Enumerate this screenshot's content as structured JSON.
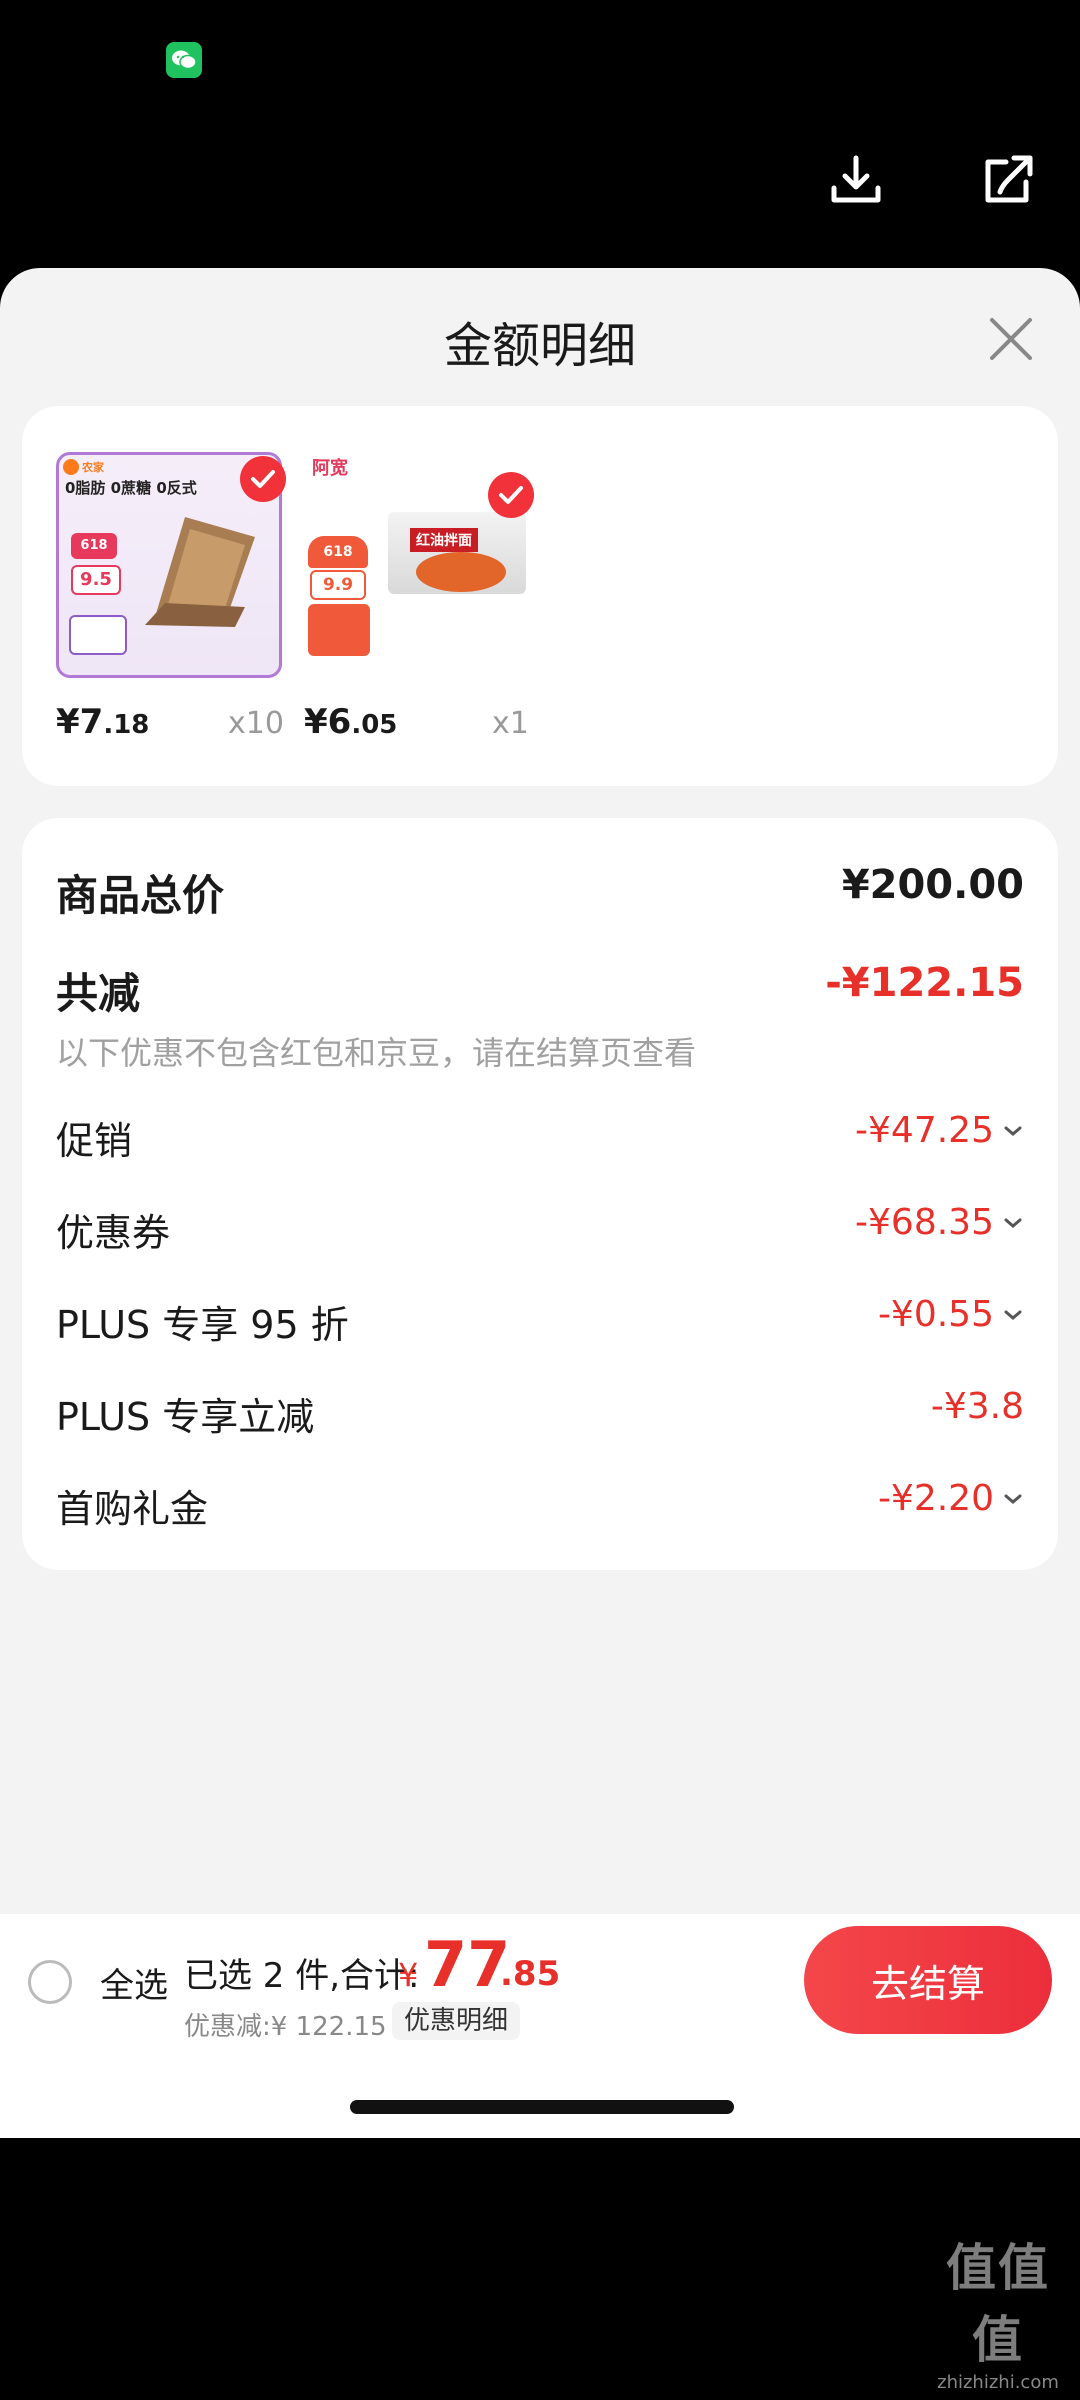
{
  "sheet": {
    "title": "金额明细"
  },
  "products": [
    {
      "name": "product-bread",
      "tag": "0脂肪 0蔗糖 0反式",
      "brand": "农家",
      "badge_618": "618",
      "badge_price": "9.5",
      "price_int": "¥7",
      "price_dec": ".18",
      "qty": "x10"
    },
    {
      "name": "product-noodles",
      "brand": "阿宽",
      "badge_618": "618",
      "badge_price": "9.9",
      "pkg_label": "红油拌面",
      "price_int": "¥6",
      "price_dec": ".05",
      "qty": "x1"
    }
  ],
  "summary": {
    "total_label": "商品总价",
    "total_value": "¥200.00",
    "reduce_label": "共减",
    "reduce_value": "-¥122.15",
    "note": "以下优惠不包含红包和京豆，请在结算页查看",
    "items": [
      {
        "label": "促销",
        "value": "-¥47.25"
      },
      {
        "label": "优惠券",
        "value": "-¥68.35"
      },
      {
        "label": "PLUS 专享 95 折",
        "value": "-¥0.55"
      },
      {
        "label": "PLUS 专享立减",
        "value": "-¥3.8"
      },
      {
        "label": "首购礼金",
        "value": "-¥2.20"
      }
    ]
  },
  "bottom": {
    "select_all": "全选",
    "selected": "已选 2 件,合计:",
    "yen": "¥",
    "total_int": "77",
    "total_dec": ".85",
    "discount": "优惠减:¥ 122.15",
    "detail_link": "优惠明细",
    "checkout": "去结算"
  },
  "watermark": {
    "big": "值值值",
    "small": "zhizhizhi.com"
  },
  "colors": {
    "accent_red": "#e8302a",
    "checkout_red": "#ec2e3b",
    "wechat_green": "#1fc25e"
  }
}
